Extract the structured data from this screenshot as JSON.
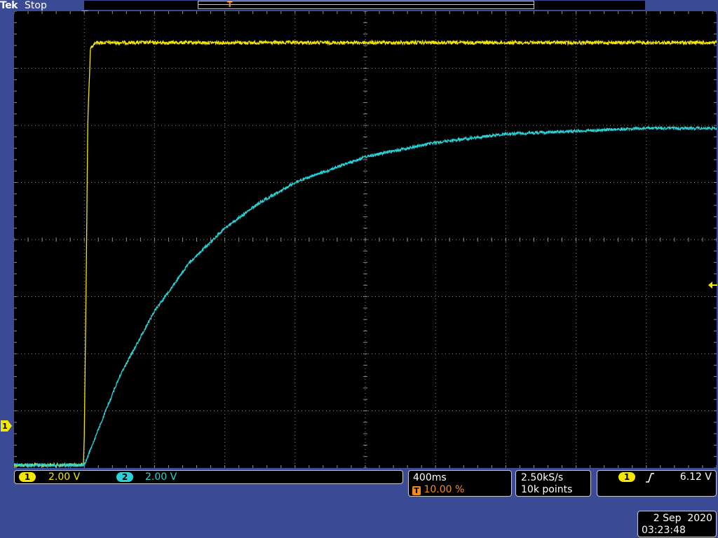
{
  "header": {
    "brand": "Tek",
    "run_state": "Stop",
    "record_trigger_marker": "T"
  },
  "markers": {
    "trigger_position_label": "T",
    "ch1_ground_label": "1"
  },
  "channels": [
    {
      "badge": "1",
      "scale": "2.00 V",
      "color": "#f5e600"
    },
    {
      "badge": "2",
      "scale": "2.00 V",
      "color": "#2ad1d6"
    }
  ],
  "timebase": {
    "scale": "400ms",
    "trigger_badge": "T",
    "trigger_position": "10.00 %"
  },
  "acquisition": {
    "sample_rate": "2.50kS/s",
    "record_length": "10k points"
  },
  "trigger": {
    "source_badge": "1",
    "slope": "rising-edge",
    "level": "6.12 V",
    "marker_color": "#f28c1b"
  },
  "datetime": {
    "date": "2 Sep  2020",
    "time": "03:23:48"
  },
  "colors": {
    "screen_bg": "#000000",
    "frame_bg": "#3b4a94",
    "graticule": "#8c8c8c",
    "ch1": "#f5e600",
    "ch2": "#2ad1d6",
    "trigger": "#f28c1b"
  },
  "chart_data": {
    "type": "line",
    "title": "",
    "xlabel": "",
    "ylabel": "",
    "grid": true,
    "xlim": [
      -0.4,
      3.6
    ],
    "x_unit": "s",
    "y_unit": "V",
    "divisions": {
      "x": 10,
      "y": 8
    },
    "volts_per_div": 2.0,
    "seconds_per_div": 0.4,
    "series": [
      {
        "channel": "1",
        "color": "#f5e600",
        "offset_divs": -3.95,
        "noise_divs": 0.03,
        "x": [
          -0.4,
          -0.005,
          0.0,
          0.01,
          0.02,
          0.035,
          0.06,
          3.6
        ],
        "y": [
          0.0,
          0.0,
          1.0,
          6.0,
          12.0,
          14.6,
          14.8,
          14.8
        ]
      },
      {
        "channel": "2",
        "color": "#2ad1d6",
        "offset_divs": -3.95,
        "noise_divs": 0.025,
        "x": [
          -0.4,
          0.0,
          0.2,
          0.4,
          0.6,
          0.8,
          1.0,
          1.2,
          1.6,
          2.0,
          2.4,
          2.8,
          3.2,
          3.6
        ],
        "y": [
          0.0,
          0.0,
          3.1,
          5.4,
          7.1,
          8.3,
          9.2,
          9.9,
          10.8,
          11.3,
          11.6,
          11.7,
          11.8,
          11.8
        ]
      }
    ]
  }
}
